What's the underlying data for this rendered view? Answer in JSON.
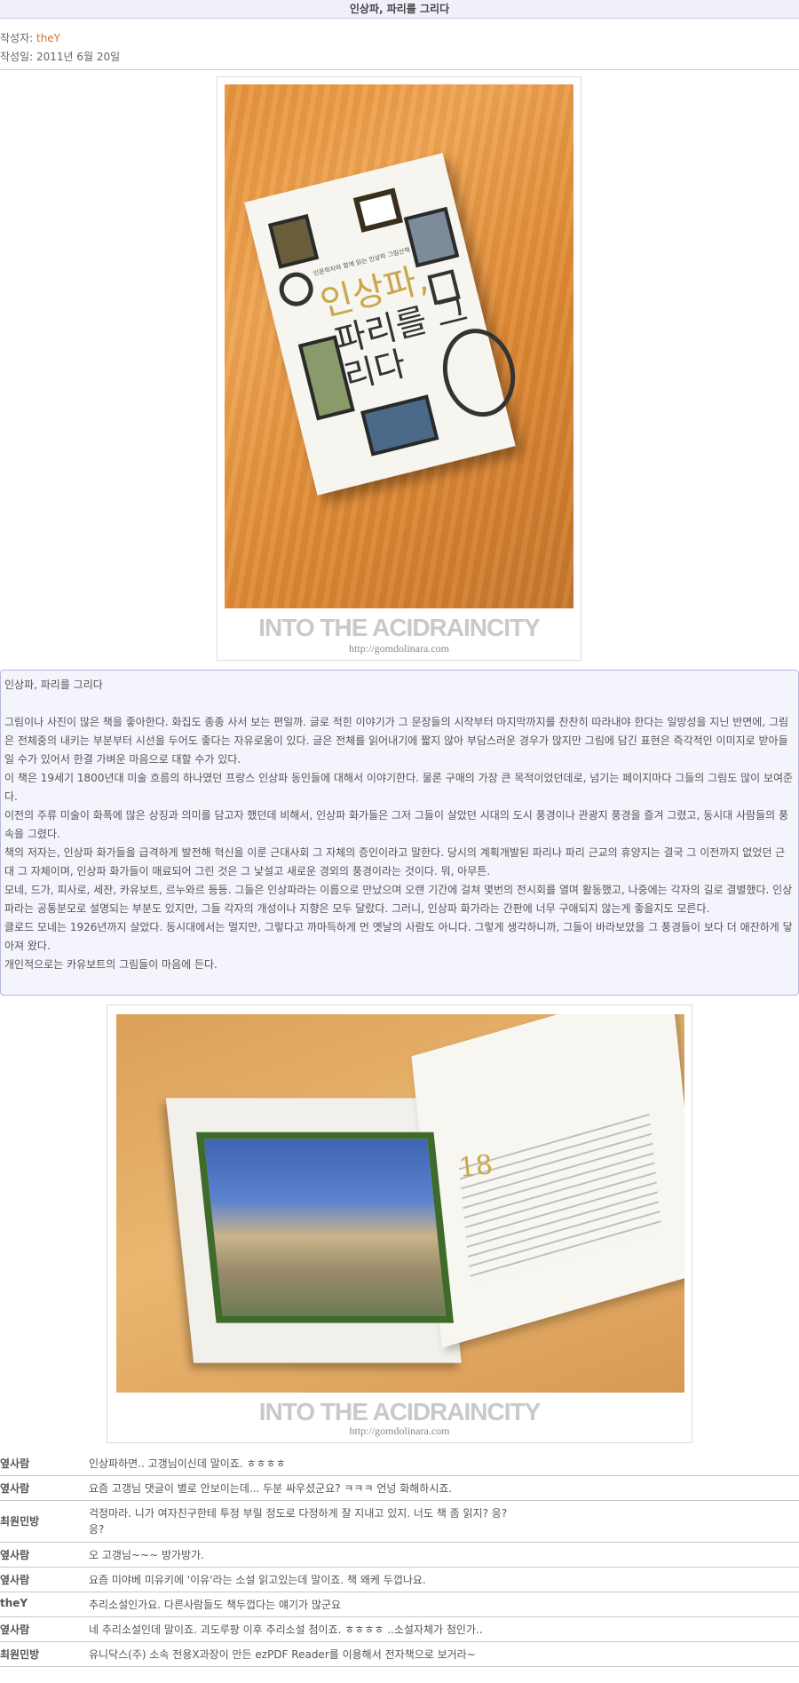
{
  "post": {
    "title": "인상파, 파리를 그리다",
    "author_label": "작성자: ",
    "author": "theY",
    "date": "작성일: 2011년 6월 20일"
  },
  "photo1": {
    "cover_subtitle": "인문학자와 함께 읽는 인상파 그림산책",
    "cover_title_1": "인상파,",
    "cover_title_2": "파리를 그리다",
    "watermark": "INTO THE ACIDRAINCITY",
    "url": "http://gomdolinara.com"
  },
  "body": {
    "heading": "인상파, 파리를 그리다",
    "paragraphs": [
      "그림이나 사진이 많은 책을 좋아한다. 화집도 종종 사서 보는 편일까. 글로 적힌 이야기가 그 문장들의 시작부터 마지막까지를 찬찬히 따라내야 한다는 일방성을 지닌 반면에, 그림은 전체중의 내키는 부분부터 시선을 두어도 좋다는 자유로움이 있다. 글은 전체를 읽어내기에 짧지 않아 부담스러운 경우가 많지만 그림에 담긴 표현은 즉각적인 이미지로 받아들일 수가 있어서 한결 가벼운 마음으로 대할 수가 있다.",
      "이 책은 19세기 1800년대 미술 흐름의 하나였던 프랑스 인상파 동인들에 대해서 이야기한다. 물론 구매의 가장 큰 목적이었던데로, 넘기는 페이지마다 그들의 그림도 많이 보여준다.",
      "이전의 주류 미술이 화폭에 많은 상징과 의미를 담고자 했던데 비해서, 인상파 화가들은 그저 그들이 살았던 시대의 도시 풍경이나 관광지 풍경을 즐겨 그렸고, 동시대 사람들의 풍속을 그렸다.",
      "책의 저자는, 인상파 화가들을 급격하게 발전해 혁신을 이룬 근대사회 그 자체의 증인이라고 말한다. 당시의 계획개발된 파리나 파리 근교의 휴양지는 결국 그 이전까지 없었던 근대 그 자체이며, 인상파 화가들이 매료되어 그린 것은 그 낯설고 새로운 경외의 풍경이라는 것이다. 뭐, 아무튼.",
      "모네, 드가, 피사로, 세잔, 카유보트, 르누와르 등등. 그들은 인상파라는 이름으로 만났으며 오랜 기간에 걸쳐 몇번의 전시회를 열며 활동했고, 나중에는 각자의 길로 결별했다. 인상파라는 공통분모로 설명되는 부분도 있지만, 그들 각자의 개성이나 지향은 모두 달랐다. 그러니, 인상파 화가라는 간판에 너무 구애되지 않는게 좋을지도 모른다.",
      "클로드 모네는 1926년까지 살았다. 동시대에서는 멀지만, 그렇다고 까마득하게 먼 옛날의 사람도 아니다. 그렇게 생각하니까, 그들이 바라보았을 그 풍경들이 보다 더 애잔하게 닿아져 왔다.",
      "개인적으로는 카유보트의 그림들이 마음에 든다."
    ]
  },
  "photo2": {
    "page_number": "18",
    "watermark": "INTO THE ACIDRAINCITY",
    "url": "http://gomdolinara.com"
  },
  "comments": [
    {
      "name": "옆사람",
      "text": "인상파하면.. 고갱님이신데 말이죠. ㅎㅎㅎㅎ"
    },
    {
      "name": "옆사람",
      "text": "요즘 고갱님 댓글이 별로 안보이는데... 두분 싸우셨군요? ㅋㅋㅋ 언넝 화해하시죠."
    },
    {
      "name": "최원민방",
      "text": "걱정마라. 니가 여자친구한테 투정 부릴 정도로 다정하게 잘 지내고 있지. 너도 책 좀 읽지? 응?",
      "text2": "응?"
    },
    {
      "name": "옆사람",
      "text": "오 고갱님~~~ 방가방가."
    },
    {
      "name": "옆사람",
      "text": "요즘 미야베 미유키에 '이유'라는 소설 읽고있는데 말이죠. 책 왜케 두껍나요."
    },
    {
      "name": "theY",
      "text": "추리소설인가요. 다른사람들도 책두껍다는 얘기가 많군요"
    },
    {
      "name": "옆사람",
      "text": "네 추리소설인데 말이죠. 괴도루팡 이후 추리소설 첨이죠. ㅎㅎㅎㅎ ..소설자체가 첨인가.."
    },
    {
      "name": "최원민방",
      "text": "유니닥스(주) 소속 전용X과장이 만든 ezPDF Reader를 이용해서 전자책으로 보거라~"
    }
  ]
}
